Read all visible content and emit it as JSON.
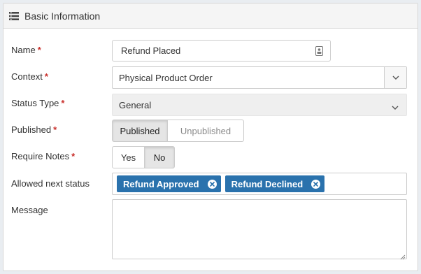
{
  "panel": {
    "title": "Basic Information",
    "header_icon": "list-icon"
  },
  "form": {
    "name": {
      "label": "Name",
      "required": "*",
      "value": "Refund Placed",
      "icon": "contact-card-icon"
    },
    "context": {
      "label": "Context",
      "required": "*",
      "value": "Physical Product Order",
      "icon": "chevron-down-icon"
    },
    "status_type": {
      "label": "Status Type",
      "required": "*",
      "value": "General",
      "icon": "chevron-down-icon"
    },
    "published": {
      "label": "Published",
      "required": "*",
      "options": [
        "Published",
        "Unpublished"
      ],
      "selected": "Published"
    },
    "require_notes": {
      "label": "Require Notes",
      "required": "*",
      "options": [
        "Yes",
        "No"
      ],
      "selected": "No"
    },
    "allowed_next_status": {
      "label": "Allowed next status",
      "tags": [
        "Refund Approved",
        "Refund Declined"
      ],
      "tag_color": "#2a72ad"
    },
    "message": {
      "label": "Message",
      "value": ""
    }
  },
  "colors": {
    "required": "#c9302c",
    "tag": "#2a72ad"
  }
}
